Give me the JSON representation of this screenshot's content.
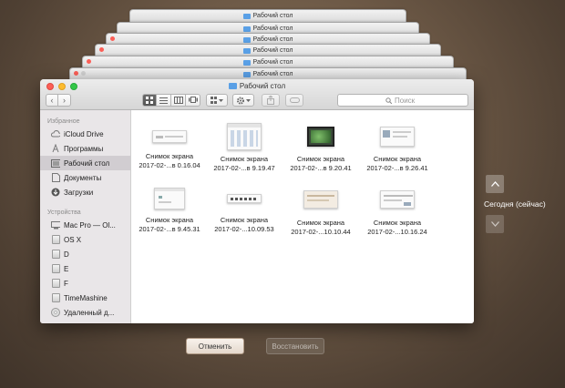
{
  "window_title": "Рабочий стол",
  "stack_title": "Рабочий стол",
  "toolbar": {
    "back_label": "‹",
    "forward_label": "›",
    "search_placeholder": "Поиск"
  },
  "sidebar": {
    "favorites_header": "Избранное",
    "favorites": [
      {
        "label": "iCloud Drive",
        "icon": "cloud-icon"
      },
      {
        "label": "Программы",
        "icon": "applications-icon"
      },
      {
        "label": "Рабочий стол",
        "icon": "desktop-icon",
        "selected": true
      },
      {
        "label": "Документы",
        "icon": "documents-icon"
      },
      {
        "label": "Загрузки",
        "icon": "downloads-icon"
      }
    ],
    "devices_header": "Устройства",
    "devices": [
      {
        "label": "Mac Pro — Ol...",
        "icon": "computer-icon"
      },
      {
        "label": "OS X",
        "icon": "disk-icon"
      },
      {
        "label": "D",
        "icon": "disk-icon"
      },
      {
        "label": "E",
        "icon": "disk-icon"
      },
      {
        "label": "F",
        "icon": "disk-icon"
      },
      {
        "label": "TimeMashine",
        "icon": "disk-icon"
      },
      {
        "label": "Удаленный д...",
        "icon": "remote-disc-icon"
      }
    ]
  },
  "files": [
    {
      "line1": "Снимок экрана",
      "line2": "2017-02-...в 0.16.04"
    },
    {
      "line1": "Снимок экрана",
      "line2": "2017-02-...в 9.19.47"
    },
    {
      "line1": "Снимок экрана",
      "line2": "2017-02-...в 9.20.41"
    },
    {
      "line1": "Снимок экрана",
      "line2": "2017-02-...в 9.26.41"
    },
    {
      "line1": "Снимок экрана",
      "line2": "2017-02-...в 9.45.31"
    },
    {
      "line1": "Снимок экрана",
      "line2": "2017-02-...10.09.53"
    },
    {
      "line1": "Снимок экрана",
      "line2": "2017-02-...10.10.44"
    },
    {
      "line1": "Снимок экрана",
      "line2": "2017-02-...10.16.24"
    }
  ],
  "timeline": {
    "current_label": "Сегодня (сейчас)"
  },
  "buttons": {
    "cancel": "Отменить",
    "restore": "Восстановить"
  },
  "colors": {
    "accent_folder": "#5aa0e6",
    "close": "#fc5f57",
    "minimize": "#fdbc2e",
    "zoom": "#33c748"
  }
}
